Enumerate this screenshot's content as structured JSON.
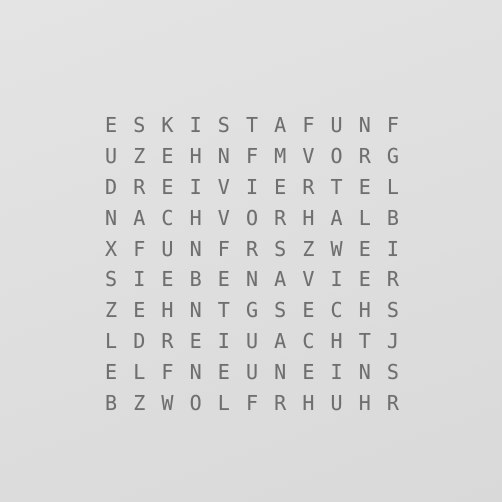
{
  "word_clock": {
    "rows": [
      [
        "E",
        "S",
        "K",
        "I",
        "S",
        "T",
        "A",
        "F",
        "U",
        "N",
        "F"
      ],
      [
        "U",
        "Z",
        "E",
        "H",
        "N",
        "F",
        "M",
        "V",
        "O",
        "R",
        "G"
      ],
      [
        "D",
        "R",
        "E",
        "I",
        "V",
        "I",
        "E",
        "R",
        "T",
        "E",
        "L"
      ],
      [
        "N",
        "A",
        "C",
        "H",
        "V",
        "O",
        "R",
        "H",
        "A",
        "L",
        "B"
      ],
      [
        "X",
        "F",
        "U",
        "N",
        "F",
        "R",
        "S",
        "Z",
        "W",
        "E",
        "I"
      ],
      [
        "S",
        "I",
        "E",
        "B",
        "E",
        "N",
        "A",
        "V",
        "I",
        "E",
        "R"
      ],
      [
        "Z",
        "E",
        "H",
        "N",
        "T",
        "G",
        "S",
        "E",
        "C",
        "H",
        "S"
      ],
      [
        "L",
        "D",
        "R",
        "E",
        "I",
        "U",
        "A",
        "C",
        "H",
        "T",
        "J"
      ],
      [
        "E",
        "L",
        "F",
        "N",
        "E",
        "U",
        "N",
        "E",
        "I",
        "N",
        "S"
      ],
      [
        "B",
        "Z",
        "W",
        "O",
        "L",
        "F",
        "R",
        "H",
        "U",
        "H",
        "R"
      ]
    ]
  },
  "colors": {
    "background": "#dfdfdf",
    "letter": "#6f6f6f"
  }
}
